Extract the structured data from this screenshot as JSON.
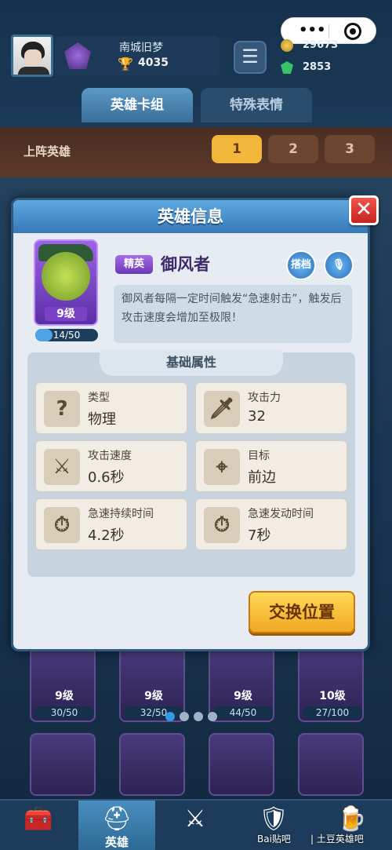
{
  "player": {
    "name": "南城旧梦",
    "trophies": "4035"
  },
  "currency": {
    "gold": "29673",
    "gems": "2853"
  },
  "tabs": [
    "英雄卡组",
    "特殊表情"
  ],
  "lineup": {
    "label": "上阵英雄",
    "slots": [
      "1",
      "2",
      "3"
    ],
    "active_slot": "1"
  },
  "background_cards": [
    {
      "level": "9级",
      "progress": "30/50"
    },
    {
      "level": "9级",
      "progress": "32/50"
    },
    {
      "level": "9级",
      "progress": "44/50"
    },
    {
      "level": "10级",
      "progress": "27/100"
    }
  ],
  "modal": {
    "title": "英雄信息",
    "close_label": "✕",
    "hero": {
      "rarity": "精英",
      "name": "御风者",
      "level": "9级",
      "progress": "14/50",
      "progress_fraction": 0.28,
      "description": "御风者每隔一定时间触发“急速射击”，触发后攻击速度会增加至极限！"
    },
    "buttons": {
      "partner": "搭档",
      "swap": "交换位置"
    },
    "attributes_title": "基础属性",
    "attributes": [
      {
        "label": "类型",
        "value": "物理",
        "icon": "question-icon"
      },
      {
        "label": "攻击力",
        "value": "32",
        "icon": "sword-icon"
      },
      {
        "label": "攻击速度",
        "value": "0.6秒",
        "icon": "fast-sword-icon"
      },
      {
        "label": "目标",
        "value": "前边",
        "icon": "crosshair-icon"
      },
      {
        "label": "急速持续时间",
        "value": "4.2秒",
        "icon": "arrow-clock-icon"
      },
      {
        "label": "急速发动时间",
        "value": "7秒",
        "icon": "arrow-clock-icon"
      }
    ],
    "pager": {
      "pages": 4,
      "current": 1
    }
  },
  "nav": [
    {
      "label": "",
      "icon": "chest-icon"
    },
    {
      "label": "英雄",
      "icon": "helmet-icon"
    },
    {
      "label": "",
      "icon": "swords-icon"
    },
    {
      "label": "",
      "icon": "badge-icon"
    },
    {
      "label": "",
      "icon": "mug-icon"
    }
  ],
  "watermark": {
    "left": "Bai贴吧",
    "right": "| 土豆英雄吧"
  }
}
